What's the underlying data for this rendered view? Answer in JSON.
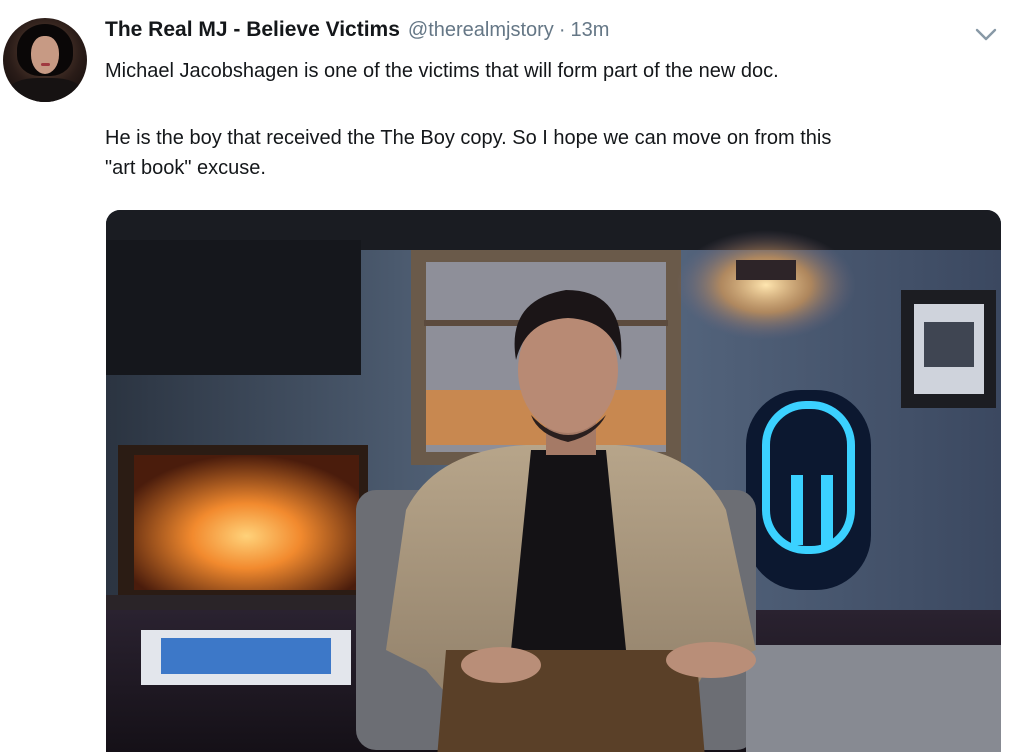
{
  "tweet": {
    "display_name": "The Real MJ - Believe Victims",
    "handle": "@therealmjstory",
    "separator": "·",
    "timestamp": "13m",
    "text_line1": "Michael Jacobshagen is one of the victims that will form part of the new doc.",
    "text_para2_line1": "He is the boy that received the The Boy copy. So I hope we can move on from this",
    "text_para2_line2": "\"art book\" excuse.",
    "avatar_icon": "profile-avatar",
    "menu_icon": "chevron-down-icon"
  },
  "colors": {
    "name": "#14171a",
    "meta": "#657786",
    "background": "#ffffff"
  }
}
